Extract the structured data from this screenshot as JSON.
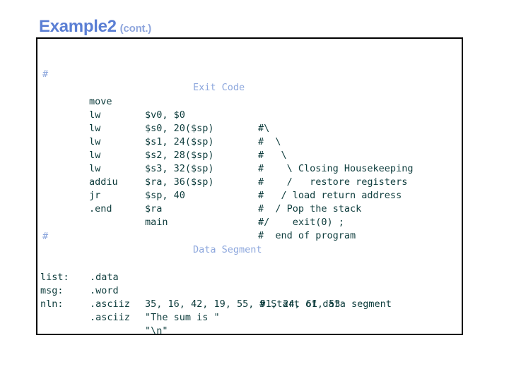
{
  "slide": {
    "title_main": "Example2",
    "title_sub": "(cont.)"
  },
  "colors": {
    "title_main": "#5b7fd4",
    "title_sub": "#8fa6dd",
    "code_text": "#0d3c3c",
    "section_head": "#8da7dd",
    "frame_border": "#000000",
    "background": "#ffffff"
  },
  "exit_section": {
    "hash": "#",
    "heading": "Exit Code",
    "lines": [
      {
        "mnemonic": "move",
        "operands": "$v0, $0",
        "comment": "#\\"
      },
      {
        "mnemonic": "lw",
        "operands": "$s0, 20($sp)",
        "comment": "#  \\"
      },
      {
        "mnemonic": "lw",
        "operands": "$s1, 24($sp)",
        "comment": "#   \\"
      },
      {
        "mnemonic": "lw",
        "operands": "$s2, 28($sp)",
        "comment": "#    \\ Closing Housekeeping"
      },
      {
        "mnemonic": "lw",
        "operands": "$s3, 32($sp)",
        "comment": "#    /   restore registers"
      },
      {
        "mnemonic": "lw",
        "operands": "$ra, 36($sp)",
        "comment": "#   / load return address"
      },
      {
        "mnemonic": "addiu",
        "operands": "$sp, 40",
        "comment": "#  / Pop the stack"
      },
      {
        "mnemonic": "jr",
        "operands": "$ra",
        "comment": "#/    exit(0) ;"
      },
      {
        "mnemonic": ".end",
        "operands": "main",
        "comment": "#  end of program"
      }
    ]
  },
  "data_section": {
    "hash": "#",
    "heading": "Data Segment",
    "lines": [
      {
        "label": "",
        "directive": ".data",
        "operands": "",
        "comment": "# Start of data segment"
      },
      {
        "label": "list:",
        "directive": ".word",
        "operands": "35, 16, 42, 19, 55, 91, 24, 61, 53",
        "comment": ""
      },
      {
        "label": "msg:",
        "directive": ".asciiz",
        "operands": "\"The sum is \"",
        "comment": ""
      },
      {
        "label": "nln:",
        "directive": ".asciiz",
        "operands": "\"\\n\"",
        "comment": ""
      }
    ]
  }
}
